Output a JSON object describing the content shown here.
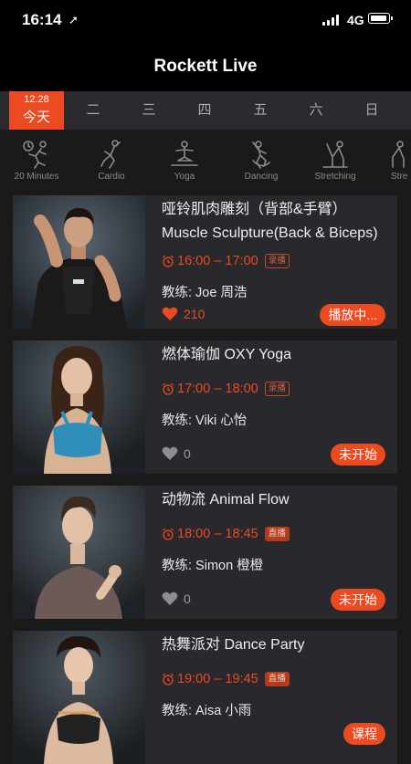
{
  "status_bar": {
    "time": "16:14",
    "network": "4G"
  },
  "nav": {
    "title": "Rockett Live"
  },
  "week": {
    "today_date": "12.28",
    "today_label": "今天",
    "days": [
      "二",
      "三",
      "四",
      "五",
      "六",
      "日"
    ]
  },
  "categories": [
    {
      "label": "20 Minutes",
      "icon": "timer-figure-icon"
    },
    {
      "label": "Cardio",
      "icon": "cardio-figure-icon"
    },
    {
      "label": "Yoga",
      "icon": "yoga-figure-icon"
    },
    {
      "label": "Dancing",
      "icon": "dancing-figure-icon"
    },
    {
      "label": "Stretching",
      "icon": "stretching-figure-icon"
    },
    {
      "label": "Stre",
      "icon": "stretching-figure-icon"
    }
  ],
  "classes": [
    {
      "title": "哑铃肌肉雕刻（背部&手臂） Muscle Sculpture(Back & Biceps)",
      "time": "16:00 – 17:00",
      "badge": "录播",
      "coach": "教练: Joe 周浩",
      "likes": "210",
      "liked": true,
      "status": "播放中..."
    },
    {
      "title": "燃体瑜伽 OXY Yoga",
      "time": "17:00 – 18:00",
      "badge": "录播",
      "coach": "教练: Viki 心怡",
      "likes": "0",
      "liked": false,
      "status": "未开始"
    },
    {
      "title": "动物流 Animal Flow",
      "time": "18:00 – 18:45",
      "badge": "直播",
      "coach": "教练: Simon 橙橙",
      "likes": "0",
      "liked": false,
      "status": "未开始"
    },
    {
      "title": "热舞派对 Dance Party",
      "time": "19:00 – 19:45",
      "badge": "直播",
      "coach": "教练: Aisa 小雨",
      "likes": "",
      "liked": false,
      "status": "课程"
    }
  ],
  "colors": {
    "accent": "#ec4a20",
    "card": "#29282c",
    "tab_bar": "#2b2a2e"
  }
}
